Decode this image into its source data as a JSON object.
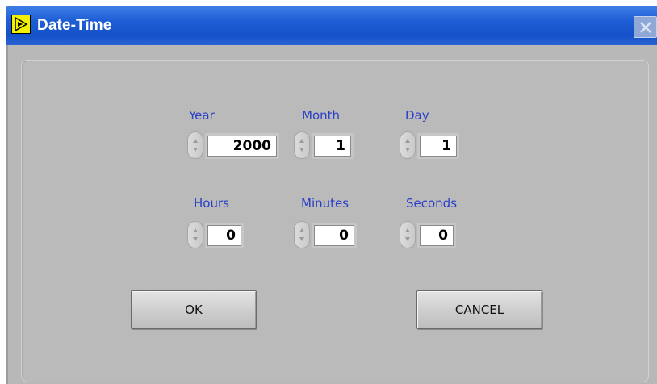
{
  "window": {
    "title": "Date-Time",
    "icon": "labview-vi-run-icon",
    "close_icon": "close-x-icon"
  },
  "fields": {
    "year": {
      "label": "Year",
      "value": "2000"
    },
    "month": {
      "label": "Month",
      "value": "1"
    },
    "day": {
      "label": "Day",
      "value": "1"
    },
    "hours": {
      "label": "Hours",
      "value": "0"
    },
    "minutes": {
      "label": "Minutes",
      "value": "0"
    },
    "seconds": {
      "label": "Seconds",
      "value": "0"
    }
  },
  "buttons": {
    "ok_label": "OK",
    "cancel_label": "CANCEL"
  },
  "colors": {
    "titlebar": "#1f5fd6",
    "label_text": "#2a3fc8",
    "panel": "#bababa"
  }
}
